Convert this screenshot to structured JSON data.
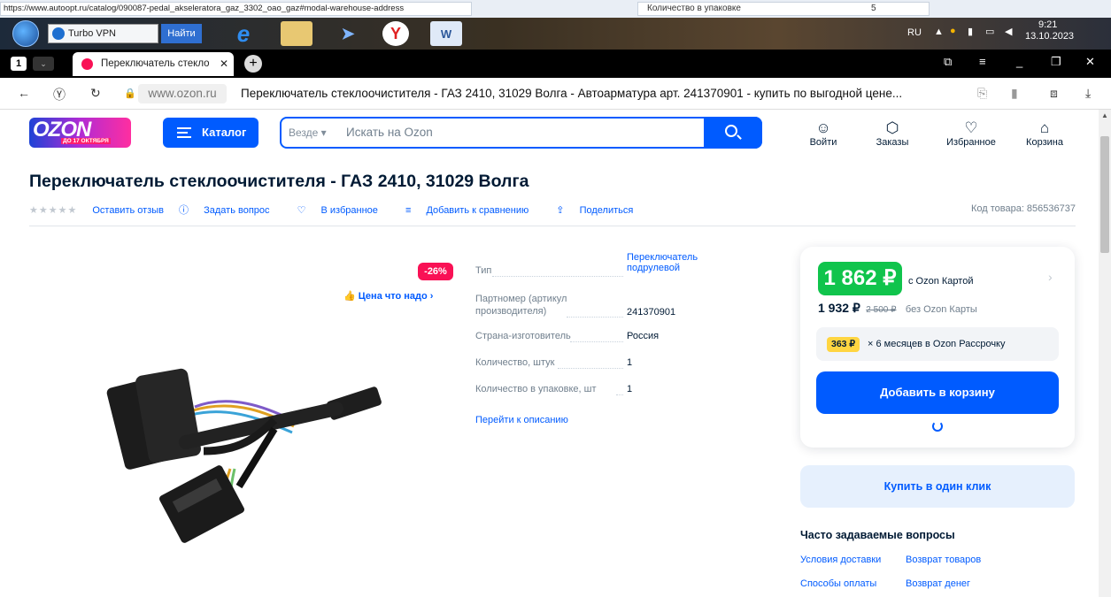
{
  "url_strip": {
    "url": "https://www.autoopt.ru/catalog/090087-pedal_akseleratora_gaz_3302_oao_gaz#modal-warehouse-address",
    "field_label": "Количество в упаковке",
    "field_value": "5"
  },
  "taskbar": {
    "vpn_label": "Turbo VPN",
    "find_button": "Найти",
    "lang": "RU",
    "time": "9:21",
    "date": "13.10.2023"
  },
  "browser": {
    "tab_count": "1",
    "tab_title": "Переключатель стекло",
    "domain": "www.ozon.ru",
    "page_title": "Переключатель стеклоочистителя - ГАЗ 2410, 31029 Волга - Автоарматура арт. 241370901 - купить по выгодной цене..."
  },
  "header": {
    "logo_text": "OZON",
    "logo_subtext": "ДО 17 ОКТЯБРЯ",
    "catalog_label": "Каталог",
    "search_scope": "Везде",
    "search_placeholder": "Искать на Ozon",
    "nav": [
      {
        "label": "Войти",
        "icon": "smile-icon"
      },
      {
        "label": "Заказы",
        "icon": "box-icon"
      },
      {
        "label": "Избранное",
        "icon": "heart-icon"
      },
      {
        "label": "Корзина",
        "icon": "bag-icon"
      }
    ]
  },
  "product": {
    "title": "Переключатель стеклоочистителя - ГАЗ 2410, 31029 Волга",
    "actions": {
      "review": "Оставить отзыв",
      "question": "Задать вопрос",
      "favorite": "В избранное",
      "compare": "Добавить к сравнению",
      "share": "Поделиться"
    },
    "code": "Код товара: 856536737",
    "discount_badge": "-26%",
    "price_good": "Цена что надо",
    "specs": [
      {
        "label": "Тип",
        "value": "Переключатель подрулевой"
      },
      {
        "label": "Партномер (артикул производителя)",
        "value": "241370901"
      },
      {
        "label": "Страна-изготовитель",
        "value": "Россия"
      },
      {
        "label": "Количество, штук",
        "value": "1"
      },
      {
        "label": "Количество в упаковке, шт",
        "value": "1"
      }
    ],
    "to_description": "Перейти к описанию"
  },
  "price_card": {
    "card_price": "1 862 ₽",
    "card_price_label": "с Ozon Картой",
    "regular_price": "1 932 ₽",
    "old_price": "2 500 ₽",
    "regular_label": "без Ozon Карты",
    "installment_chip": "363 ₽",
    "installment_text": "× 6 месяцев в Ozon Рассрочку",
    "add_to_cart": "Добавить в корзину",
    "buy_one_click": "Купить в один клик"
  },
  "faq": {
    "title": "Часто задаваемые вопросы",
    "links": [
      "Условия доставки",
      "Возврат товаров",
      "Способы оплаты",
      "Возврат денег"
    ]
  },
  "colors": {
    "accent": "#005bff",
    "green_price": "#10c44c",
    "discount": "#f91155",
    "installment": "#ffd541"
  }
}
